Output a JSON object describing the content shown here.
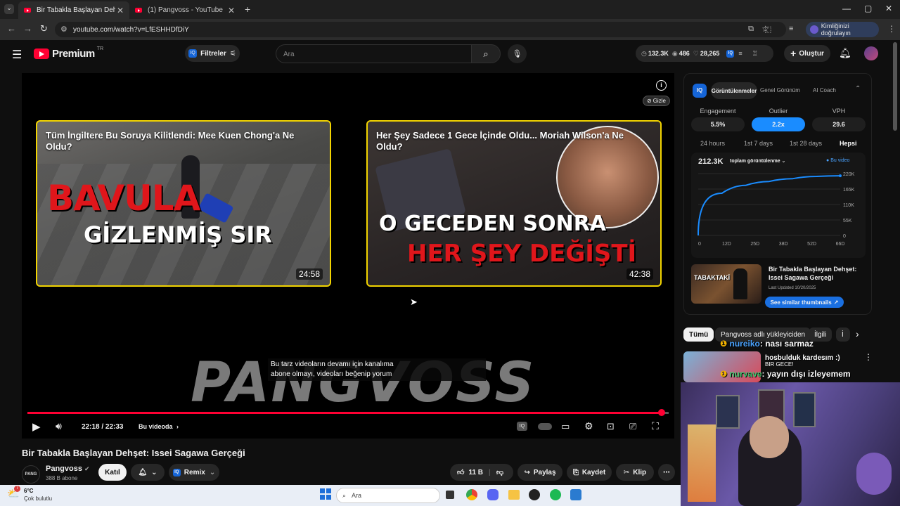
{
  "browser": {
    "tabs": [
      {
        "title": "Bir Tabakla Başlayan Dehşet: Iss",
        "active": true
      },
      {
        "title": "(1) Pangvoss - YouTube",
        "active": false
      }
    ],
    "url": "youtube.com/watch?v=LfESHHDfDiY",
    "profile_button": "Kimliğinizi doğrulayın"
  },
  "header": {
    "logo_text": "Premium",
    "logo_badge": "TR",
    "filters_label": "Filtreler",
    "search_placeholder": "Ara",
    "stats": {
      "subs": "132.3K",
      "views": "486",
      "likes": "28,265"
    },
    "create_label": "Oluştur"
  },
  "player": {
    "hide_label": "Gizle",
    "endcards": [
      {
        "title": "Tüm İngiltere Bu Soruya Kilitlendi: Mee Kuen Chong'a Ne Oldu?",
        "big1": "BAVULA",
        "big2": "GİZLENMİŞ SIR",
        "duration": "24:58"
      },
      {
        "title": "Her Şey Sadece 1 Gece İçinde Oldu... Moriah Wilson'a Ne Oldu?",
        "big1": "O GECEDEN SONRA",
        "big2": "HER ŞEY DEĞİŞTİ",
        "duration": "42:38"
      }
    ],
    "caption_line1": "Bu tarz videoların devamı için kanalıma",
    "caption_line2": "abone olmayı, videoları beğenip yorum",
    "watermark": "PANGVOSS",
    "time": "22:18 / 22:33",
    "chapter": "Bu videoda",
    "progress": 0.989
  },
  "video": {
    "title": "Bir Tabakla Başlayan Dehşet: Issei Sagawa Gerçeği",
    "channel": "Pangvoss",
    "subs": "388 B abone",
    "join_label": "Katıl",
    "remix_label": "Remix",
    "likes": "11 B",
    "share_label": "Paylaş",
    "save_label": "Kaydet",
    "clip_label": "Klip"
  },
  "iq": {
    "tabs": [
      "Görüntülenmeler",
      "Genel Görünüm",
      "AI Coach"
    ],
    "metrics": [
      {
        "label": "Engagement",
        "value": "5.5%"
      },
      {
        "label": "Outlier",
        "value": "2.2x"
      },
      {
        "label": "VPH",
        "value": "29.6"
      }
    ],
    "ranges": [
      "24 hours",
      "1st 7 days",
      "1st 28 days",
      "Hepsi"
    ],
    "total_views": "212.3K",
    "views_dropdown": "toplam görüntülenme",
    "legend": "Bu video",
    "similar_title": "Bir Tabakla Başlayan Dehşet: Issei Sagawa Gerçeği",
    "similar_updated": "Last Updated 10/20/2025",
    "similar_button": "See similar thumbnails",
    "thumb_text": "TABAKTAKİ"
  },
  "chart_data": {
    "type": "line",
    "x": [
      "0",
      "12D",
      "25D",
      "38D",
      "52D",
      "66D"
    ],
    "yticks": [
      "220K",
      "165K",
      "110K",
      "55K",
      "0"
    ],
    "ylim": [
      0,
      220000
    ],
    "series": [
      {
        "name": "Bu video",
        "values": [
          0,
          150000,
          178000,
          192000,
          202000,
          210000,
          212300
        ]
      }
    ]
  },
  "chips": [
    "Tümü",
    "Pangvoss adlı yükleyiciden",
    "İlgili",
    "İ"
  ],
  "chat": [
    {
      "user": "nureiko",
      "text": ": nası sarmaz"
    },
    {
      "user": "nurvave",
      "text": ": yayın dışı izleyemem"
    }
  ],
  "side_overlay": {
    "line1": "hosbulduk kardesım :)",
    "line2": "BIR GECE!"
  },
  "taskbar": {
    "weather_temp": "6°C",
    "weather_desc": "Çok bulutlu",
    "search": "Ara"
  }
}
